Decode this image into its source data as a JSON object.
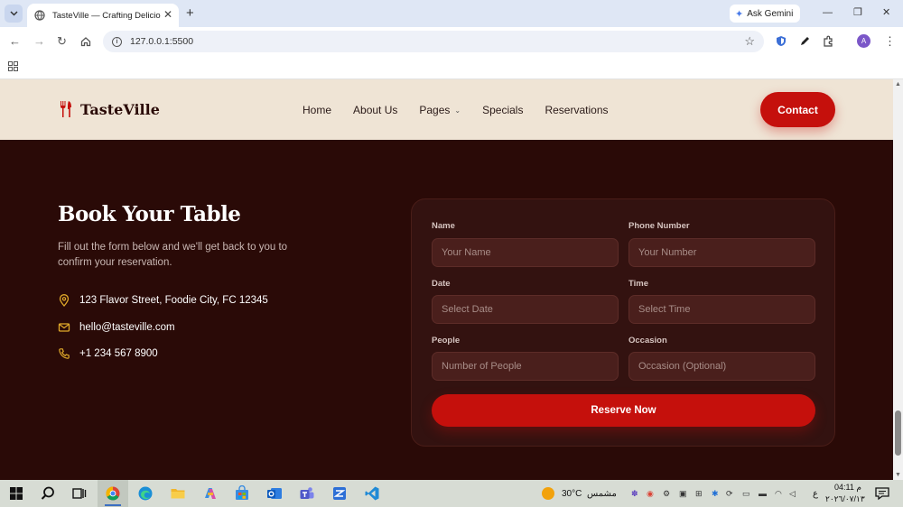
{
  "browser": {
    "tab_title": "TasteVille — Crafting Delicious",
    "url": "127.0.0.1:5500",
    "ask_gemini": "Ask Gemini",
    "avatar_letter": "A"
  },
  "header": {
    "brand": "TasteVille",
    "nav": [
      {
        "label": "Home"
      },
      {
        "label": "About Us"
      },
      {
        "label": "Pages"
      },
      {
        "label": "Specials"
      },
      {
        "label": "Reservations"
      }
    ],
    "contact_label": "Contact"
  },
  "booking": {
    "title": "Book Your Table",
    "description": "Fill out the form below and we'll get back to you to confirm your reservation.",
    "address": "123 Flavor Street, Foodie City, FC 12345",
    "email": "hello@tasteville.com",
    "phone": "+1 234 567 8900"
  },
  "form": {
    "name_label": "Name",
    "name_placeholder": "Your Name",
    "phone_label": "Phone Number",
    "phone_placeholder": "Your Number",
    "date_label": "Date",
    "date_placeholder": "Select Date",
    "time_label": "Time",
    "time_placeholder": "Select Time",
    "people_label": "People",
    "people_placeholder": "Number of People",
    "occasion_label": "Occasion",
    "occasion_placeholder": "Occasion (Optional)",
    "submit_label": "Reserve Now"
  },
  "taskbar": {
    "temperature": "30°C",
    "weather_text": "مشمس",
    "time": "04:11 م",
    "date": "٢٠٢٦/٠٧/١٣",
    "lang": "ع"
  },
  "colors": {
    "accent": "#c5100c",
    "header_bg": "#efe4d5",
    "section_bg": "#2a0a07"
  }
}
